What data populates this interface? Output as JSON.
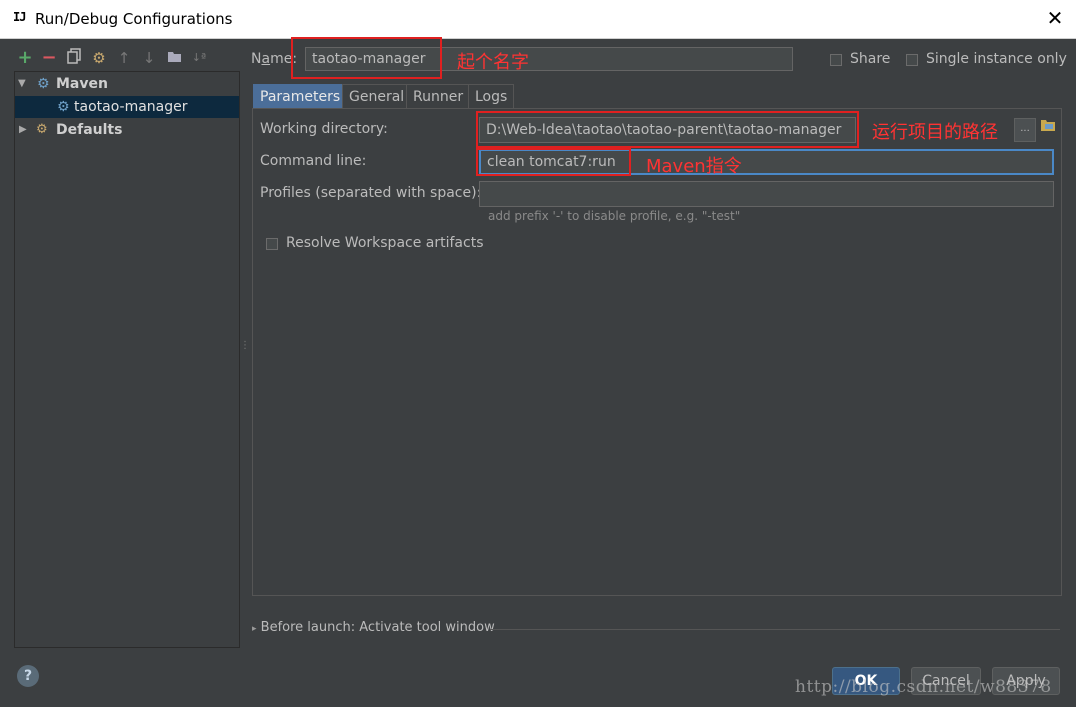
{
  "window": {
    "icon_text": "IJ",
    "title": "Run/Debug Configurations",
    "close_symbol": "✕"
  },
  "toolbar": {
    "icons": [
      "add-icon",
      "remove-icon",
      "copy-icon",
      "edit-defaults-icon",
      "move-up-icon",
      "move-down-icon",
      "folder-icon",
      "sort-icon"
    ]
  },
  "tree": {
    "items": [
      {
        "label": "Maven",
        "expanded": true
      },
      {
        "label": "taotao-manager",
        "selected": true
      },
      {
        "label": "Defaults",
        "expanded": false
      }
    ]
  },
  "name_row": {
    "label_prefix": "N",
    "label_underlined": "a",
    "label_suffix": "me:",
    "value": "taotao-manager",
    "annotation": "起个名字",
    "share_label": "Share",
    "single_instance_label": "Single instance only"
  },
  "tabs": [
    {
      "label": "Parameters",
      "active": true
    },
    {
      "label": "General"
    },
    {
      "label": "Runner"
    },
    {
      "label": "Logs"
    }
  ],
  "parameters": {
    "working_dir_label": "Working directory:",
    "working_dir_value": "D:\\Web-Idea\\taotao\\taotao-parent\\taotao-manager",
    "working_dir_annotation": "运行项目的路径",
    "browse_label": "...",
    "command_line_label": "Command line:",
    "command_line_value": "clean tomcat7:run",
    "command_annotation": "Maven指令",
    "profiles_label": "Profiles (separated with space):",
    "profiles_value": "",
    "profiles_hint": "add prefix '-' to disable profile, e.g. \"-test\"",
    "resolve_label": "Resolve Workspace artifacts"
  },
  "before_launch": {
    "label": "Before launch: Activate tool window"
  },
  "buttons": {
    "help": "?",
    "ok": "OK",
    "cancel": "Cancel",
    "apply": "Apply"
  },
  "watermark": "http://blog.csdn.net/w88378",
  "colors": {
    "background": "#3c3f41",
    "accent": "#4b6e99",
    "annotation": "#e02020",
    "focus_border": "#4a88c7"
  }
}
